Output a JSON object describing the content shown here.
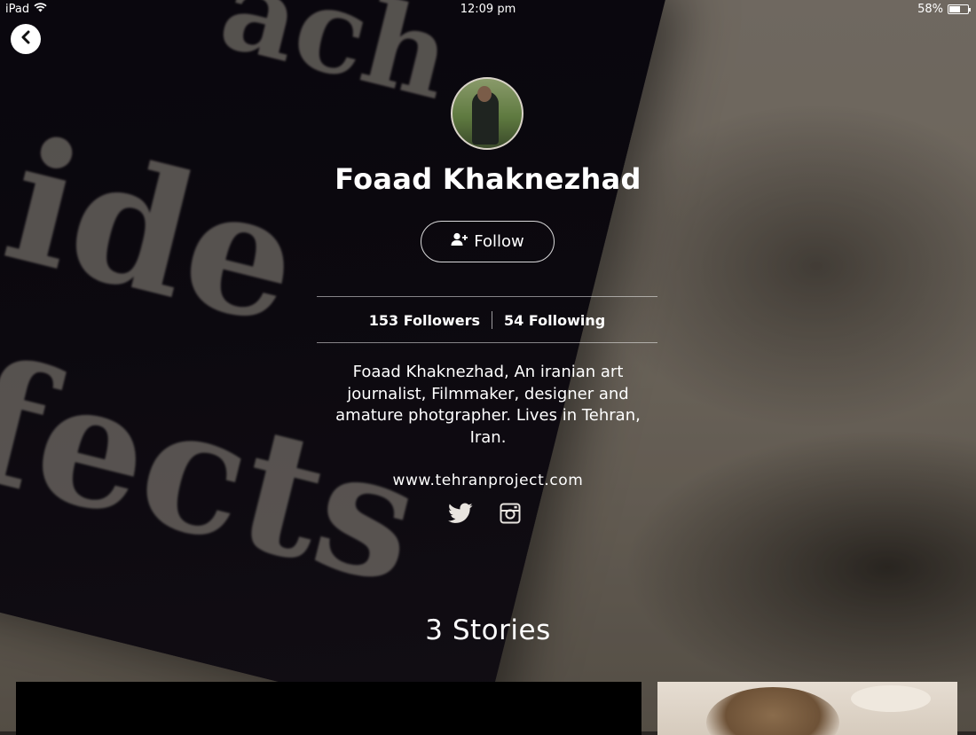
{
  "status_bar": {
    "device": "iPad",
    "time": "12:09 pm",
    "battery_text": "58%",
    "battery_level": 0.58
  },
  "profile": {
    "name": "Foaad Khaknezhad",
    "follow_label": "Follow",
    "followers_label": "153 Followers",
    "following_label": "54 Following",
    "bio": "Foaad Khaknezhad, An iranian art journalist, Filmmaker, designer and amature photgrapher. Lives in Tehran, Iran.",
    "website": "www.tehranproject.com",
    "social_icons": [
      "twitter-icon",
      "instagram-icon"
    ]
  },
  "stories": {
    "title": "3 Stories"
  },
  "background": {
    "book_text": [
      "ach",
      "ide",
      "fects"
    ]
  },
  "colors": {
    "text": "#ffffff",
    "back_button_bg": "#ffffff",
    "back_button_icon": "#111111"
  }
}
